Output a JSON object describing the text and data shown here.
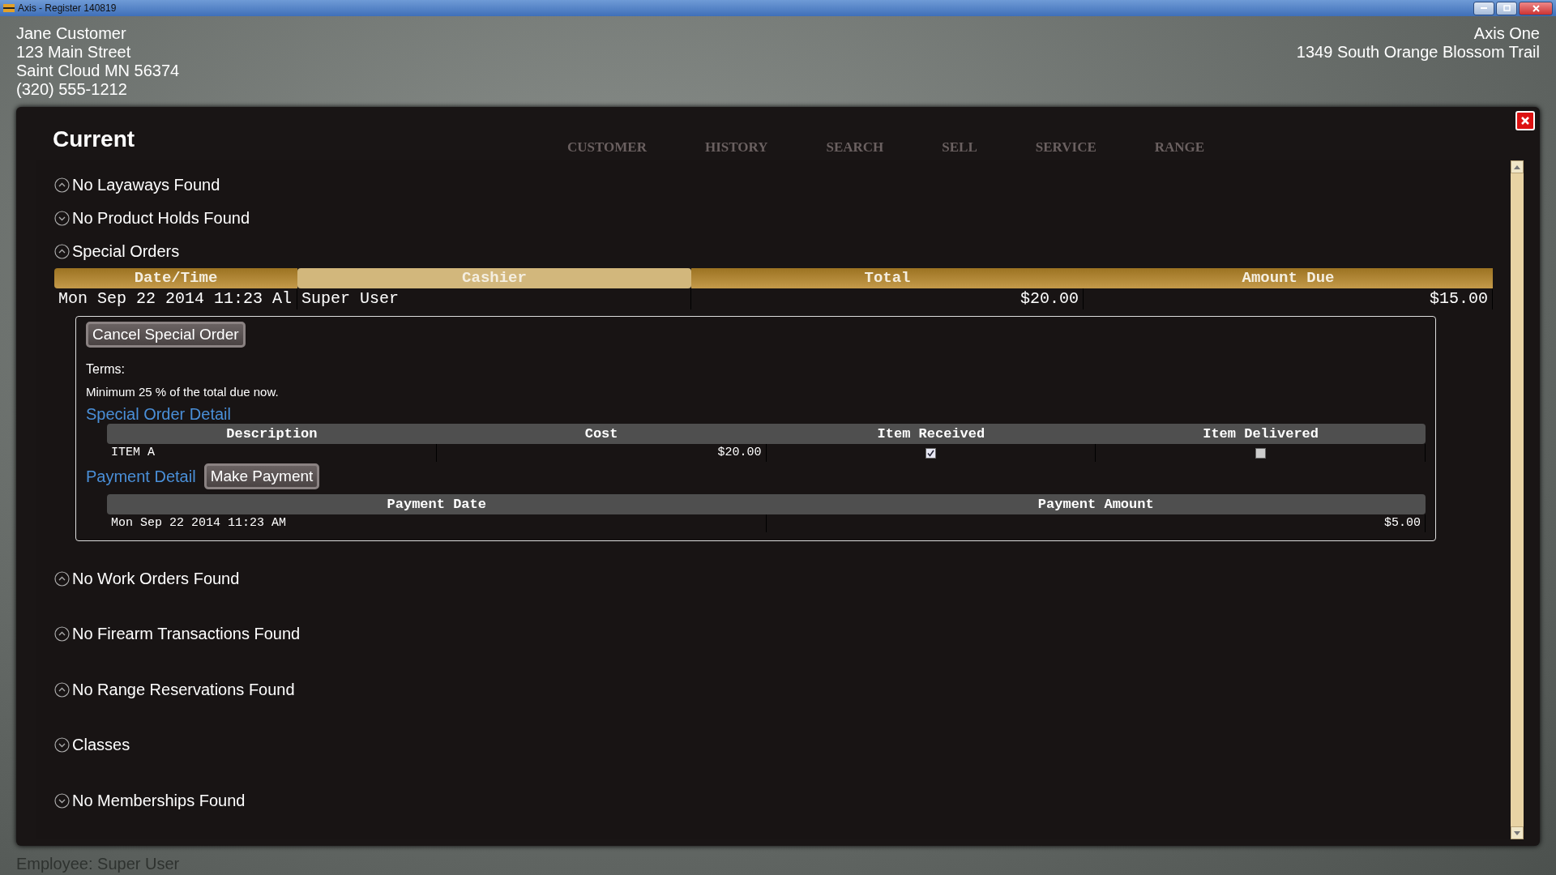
{
  "window": {
    "title": "Axis - Register  140819"
  },
  "customer": {
    "name": "Jane Customer",
    "lines": [
      "123 Main Street",
      "Saint Cloud MN 56374",
      "(320) 555-1212"
    ]
  },
  "store": {
    "name": "Axis One",
    "address": "1349 South Orange Blossom Trail"
  },
  "background_tabs": [
    "CUSTOMER",
    "HISTORY",
    "SEARCH",
    "SELL",
    "SERVICE",
    "RANGE"
  ],
  "status_bar": {
    "employee": "Employee: Super User"
  },
  "dialog": {
    "title": "Current",
    "sections": [
      {
        "kind": "empty",
        "title": "No Layaways Found",
        "expanded": true
      },
      {
        "kind": "empty",
        "title": "No Product Holds Found",
        "expanded": false
      },
      {
        "kind": "orders",
        "title": "Special Orders",
        "expanded": true,
        "table": {
          "columns": [
            {
              "label": "Date/Time",
              "selected": false
            },
            {
              "label": "Cashier",
              "selected": true
            },
            {
              "label": "Total",
              "selected": false
            },
            {
              "label": "Amount Due",
              "selected": false
            }
          ],
          "rows": [
            [
              "Mon Sep 22 2014 11:23 Al",
              "Super User",
              "$20.00",
              "$15.00"
            ]
          ]
        },
        "detail": {
          "cancel_button": "Cancel Special Order",
          "terms_label": "Terms:",
          "terms": "Minimum 25 % of the total due now.",
          "items_title": "Special Order Detail",
          "items_columns": [
            "Description",
            "Cost",
            "Item Received",
            "Item Delivered"
          ],
          "items": [
            {
              "description": "ITEM A",
              "cost": "$20.00",
              "received": true,
              "delivered": false
            }
          ],
          "payments_title": "Payment Detail",
          "payment_button": "Make Payment",
          "payments_columns": [
            "Payment Date",
            "Payment Amount"
          ],
          "payments": [
            {
              "date": "Mon Sep 22 2014 11:23 AM",
              "amount": "$5.00"
            }
          ]
        }
      },
      {
        "kind": "empty",
        "title": "No Work Orders Found",
        "expanded": true
      },
      {
        "kind": "empty",
        "title": "No Firearm Transactions Found",
        "expanded": true
      },
      {
        "kind": "empty",
        "title": "No Range Reservations Found",
        "expanded": true
      },
      {
        "kind": "empty",
        "title": "Classes",
        "expanded": false
      },
      {
        "kind": "empty",
        "title": "No Memberships Found",
        "expanded": false
      }
    ]
  }
}
